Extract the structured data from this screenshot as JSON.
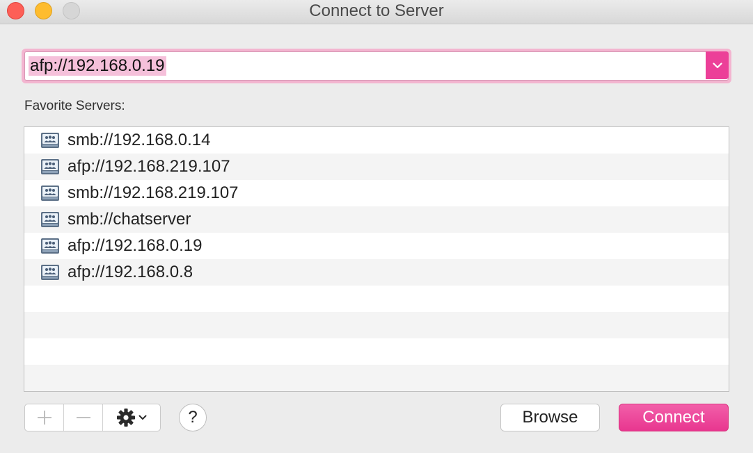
{
  "window": {
    "title": "Connect to Server",
    "traffic_lights": [
      "close",
      "minimize",
      "zoom"
    ]
  },
  "address": {
    "value": "afp://192.168.0.19",
    "dropdown_icon": "chevron-down-icon",
    "accent": "#ec3f98"
  },
  "favorites": {
    "label": "Favorite Servers:",
    "icon": "network-server-icon",
    "items": [
      "smb://192.168.0.14",
      "afp://192.168.219.107",
      "smb://192.168.219.107",
      "smb://chatserver",
      "afp://192.168.0.19",
      "afp://192.168.0.8"
    ],
    "empty_rows": 4
  },
  "toolbar": {
    "add_icon": "plus-icon",
    "remove_icon": "minus-icon",
    "action_icon": "gear-icon",
    "help_label": "?"
  },
  "buttons": {
    "browse_label": "Browse",
    "connect_label": "Connect"
  },
  "colors": {
    "accent": "#ec3f98",
    "selection": "#f5c0da",
    "focus_ring": "#f3b5d0"
  }
}
